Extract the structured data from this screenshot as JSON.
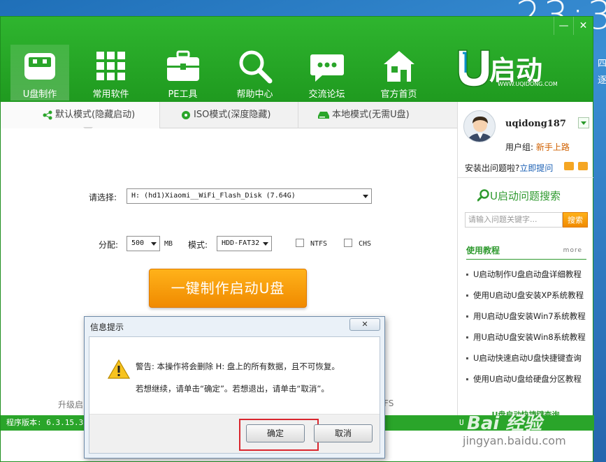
{
  "desktop": {
    "clock": "23:3",
    "day1": "四",
    "day2": "逐"
  },
  "window": {
    "close_label": "✕",
    "minimize_label": "—"
  },
  "nav": [
    {
      "label": "U盘制作",
      "icon": "usb-drive-icon"
    },
    {
      "label": "常用软件",
      "icon": "grid-apps-icon"
    },
    {
      "label": "PE工具",
      "icon": "toolbox-icon"
    },
    {
      "label": "帮助中心",
      "icon": "magnifier-icon"
    },
    {
      "label": "交流论坛",
      "icon": "chat-bubble-icon"
    },
    {
      "label": "官方首页",
      "icon": "home-icon"
    }
  ],
  "logo": {
    "text": "启动",
    "url": "WWW.UQIDONG.COM"
  },
  "tabs": [
    {
      "label": "默认模式(隐藏启动)"
    },
    {
      "label": "ISO模式(深度隐藏)"
    },
    {
      "label": "本地模式(无需U盘)"
    }
  ],
  "form": {
    "select_label": "请选择:",
    "disk_value": "H: (hd1)Xiaomi__WiFi_Flash_Disk (7.64G)",
    "alloc_label": "分配:",
    "alloc_value": "500",
    "alloc_unit": "MB",
    "mode_label": "模式:",
    "mode_value": "HDD-FAT32",
    "ntfs_label": "NTFS",
    "chs_label": "CHS"
  },
  "main_button": "一键制作启动U盘",
  "background_fragments": {
    "left": "升级启",
    "right": "FS"
  },
  "status": {
    "version": "程序版本: 6.3.15.3",
    "right": "U"
  },
  "side": {
    "username": "uqidong187",
    "group_label": "用户组: ",
    "group_value": "新手上路",
    "help_text": "安装出问题啦?",
    "help_link": "立即提问",
    "search_title": "U启动问题搜索",
    "search_placeholder": "请输入问题关键字...",
    "search_button": "搜索",
    "tutorial_title": "使用教程",
    "tutorial_more": "more",
    "tutorials": [
      "U启动制作U盘启动盘详细教程",
      "使用U启动U盘安装XP系统教程",
      "用U启动U盘安装Win7系统教程",
      "用U启动U盘安装Win8系统教程",
      "U启动快速启动U盘快捷键查询",
      "使用U启动U盘给硬盘分区教程"
    ],
    "quick_title": "U盘启动快捷键查询"
  },
  "dialog": {
    "title": "信息提示",
    "close": "✕",
    "message1": "警告: 本操作将会删除 H: 盘上的所有数据，且不可恢复。",
    "message2": "若想继续，请单击“确定”。若想退出，请单击“取消”。",
    "ok": "确定",
    "cancel": "取消"
  },
  "watermark": {
    "logo": "Bai 经验",
    "url": "jingyan.baidu.com"
  },
  "colors": {
    "brand_green": "#2aa52a",
    "accent_orange": "#f5a000",
    "highlight_red": "#d9262e"
  }
}
